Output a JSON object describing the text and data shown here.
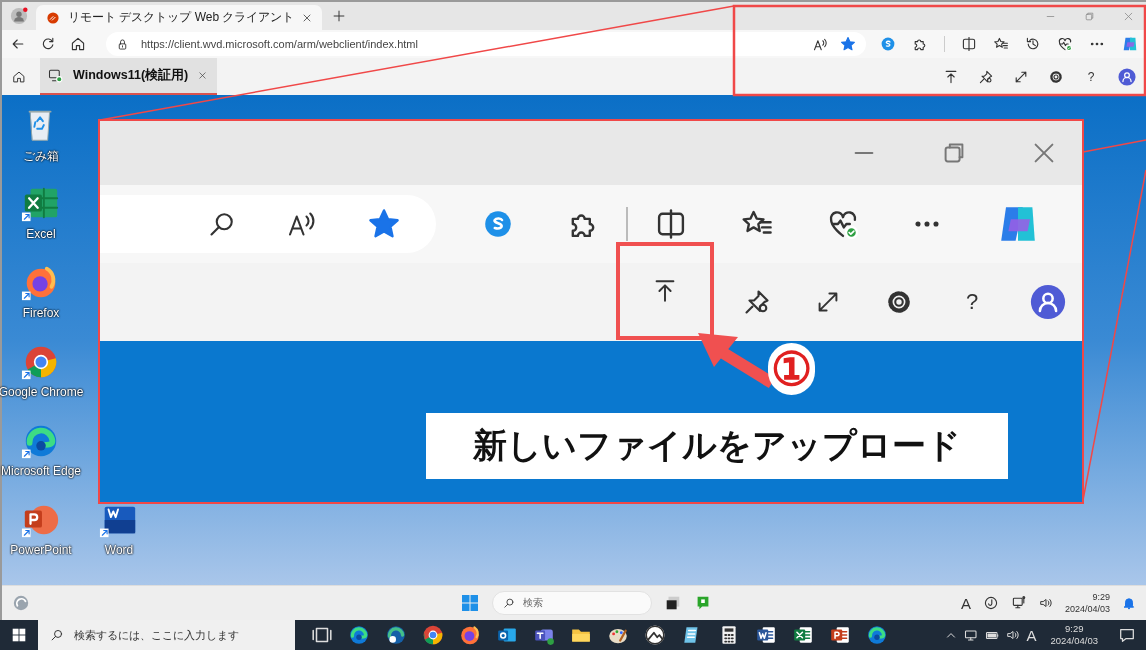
{
  "browser": {
    "tabs": [
      {
        "title": "リモート デスクトップ Web クライアント",
        "selected": true
      }
    ],
    "url": "https://client.wvd.microsoft.com/arm/webclient/index.html"
  },
  "rd_toolbar": {
    "sessions": [
      {
        "label": "Windows11(検証用)",
        "selected": true
      }
    ],
    "help": "?"
  },
  "desktop": {
    "icons": [
      {
        "label": "ごみ箱",
        "kind": "recycle_bin"
      },
      {
        "label": "Excel",
        "kind": "excel"
      },
      {
        "label": "Firefox",
        "kind": "firefox"
      },
      {
        "label": "Google Chrome",
        "kind": "chrome"
      },
      {
        "label": "Microsoft Edge",
        "kind": "edge"
      },
      {
        "label": "PowerPoint",
        "kind": "powerpoint"
      },
      {
        "label": "Word",
        "kind": "word"
      }
    ]
  },
  "remote_taskbar": {
    "search_placeholder": "検索",
    "ime": "A",
    "time": "9:29",
    "date": "2024/04/03"
  },
  "host_taskbar": {
    "search_placeholder": "検索するには、ここに入力します",
    "ime": "A",
    "time": "9:29",
    "date": "2024/04/03"
  },
  "callout": {
    "help": "?",
    "step": "①",
    "caption": "新しいファイルをアップロード"
  }
}
